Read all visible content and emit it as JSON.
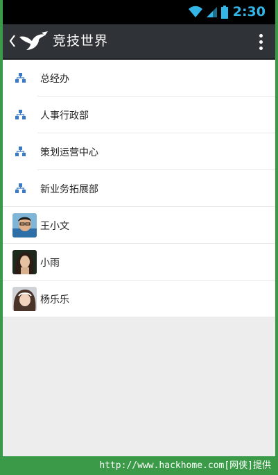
{
  "status_bar": {
    "time": "2:30",
    "icons": [
      "wifi-icon",
      "signal-icon",
      "battery-icon"
    ],
    "accent_color": "#33b5e5"
  },
  "action_bar": {
    "title": "竞技世界",
    "icons": [
      "back-chevron-icon",
      "bird-logo-icon",
      "overflow-menu-icon"
    ],
    "background_color": "#2f3337"
  },
  "departments": [
    {
      "label": "总经办",
      "icon": "org-chart-icon"
    },
    {
      "label": "人事行政部",
      "icon": "org-chart-icon"
    },
    {
      "label": "策划运营中心",
      "icon": "org-chart-icon"
    },
    {
      "label": "新业务拓展部",
      "icon": "org-chart-icon"
    }
  ],
  "contacts": [
    {
      "name": "王小文",
      "avatar": "avatar-photo"
    },
    {
      "name": "小雨",
      "avatar": "avatar-photo"
    },
    {
      "name": "杨乐乐",
      "avatar": "avatar-photo"
    }
  ],
  "watermark": "http://www.hackhome.com[网侠]提供"
}
